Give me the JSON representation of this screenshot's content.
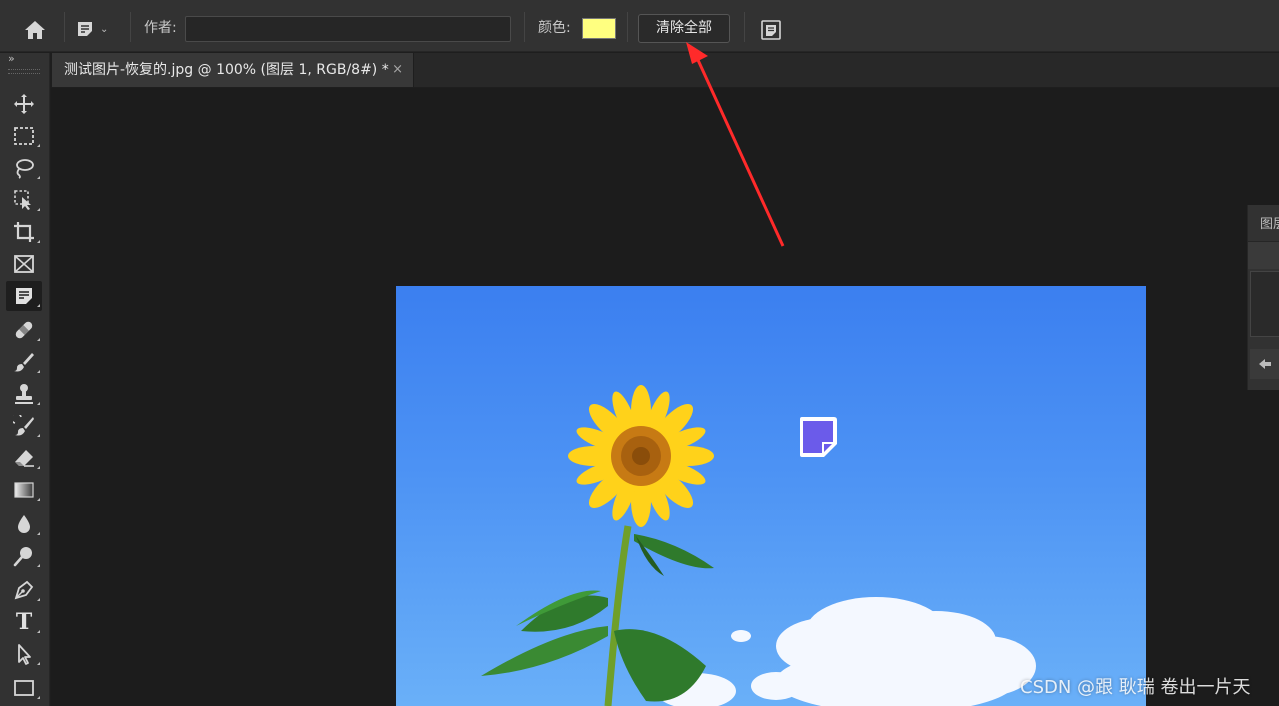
{
  "options_bar": {
    "author_label": "作者:",
    "author_value": "",
    "color_label": "颜色:",
    "note_color": "#ffff80",
    "clear_all_label": "清除全部",
    "icons": [
      "home-icon",
      "note-preset-icon",
      "chevron-down-icon",
      "notes-panel-icon"
    ]
  },
  "document_tab": {
    "title": "测试图片-恢复的.jpg @ 100% (图层 1, RGB/8#) *",
    "close_glyph": "×"
  },
  "toolbar": {
    "collapse_glyph": "»",
    "tools": [
      "move-tool",
      "rectangular-marquee-tool",
      "lasso-tool",
      "object-selection-tool",
      "crop-tool",
      "frame-tool",
      "note-tool",
      "spot-healing-brush-tool",
      "brush-tool",
      "clone-stamp-tool",
      "history-brush-tool",
      "eraser-tool",
      "gradient-tool",
      "blur-tool",
      "dodge-tool",
      "pen-tool",
      "type-tool",
      "path-selection-tool",
      "rectangle-tool"
    ],
    "active_tool": "note-tool",
    "type_tool_glyph": "T"
  },
  "right_panel": {
    "title": "图层"
  },
  "canvas": {
    "note_marker_color": "#6b5bea",
    "annotation_arrow_color": "#ff2a2a"
  },
  "watermark": "CSDN @跟 耿瑞 卷出一片天"
}
